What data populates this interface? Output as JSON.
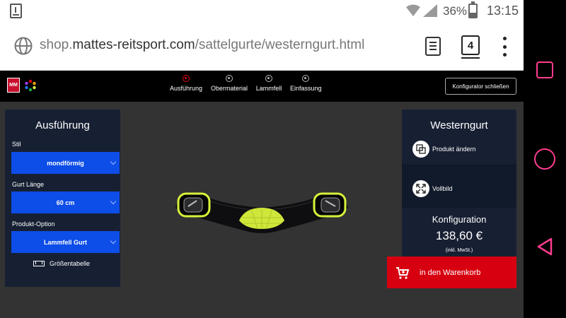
{
  "statusbar": {
    "battery_percent": "36%",
    "clock": "13:15"
  },
  "browser": {
    "url_prefix": "shop.",
    "url_domain": "mattes-reitsport.com",
    "url_path": "/sattelgurte/westerngurt.html",
    "tab_count": "4"
  },
  "header": {
    "steps": [
      {
        "label": "Ausführung",
        "active": true
      },
      {
        "label": "Obermaterial",
        "active": false
      },
      {
        "label": "Lammfell",
        "active": false
      },
      {
        "label": "Einfassung",
        "active": false
      }
    ],
    "close_label": "Konfigurator schließen"
  },
  "left_panel": {
    "title": "Ausführung",
    "fields": [
      {
        "label": "Stil",
        "value": "mondförmig"
      },
      {
        "label": "Gurt Länge",
        "value": "60 cm"
      },
      {
        "label": "Produkt-Option",
        "value": "Lammfell Gurt"
      }
    ],
    "size_table_label": "Größentabelle"
  },
  "right_panel": {
    "title": "Westerngurt",
    "change_product_label": "Produkt ändern",
    "fullscreen_label": "Vollbild",
    "config_label": "Konfiguration",
    "price": "138,60 €",
    "vat_note": "(inkl. MwSt.)"
  },
  "cart": {
    "label": "in den Warenkorb"
  },
  "colors": {
    "accent_blue": "#0d4de8",
    "panel": "#172033",
    "cart_red": "#d70010",
    "android_nav": "#ff3c8e",
    "neon_yellow": "#d8f23a"
  }
}
